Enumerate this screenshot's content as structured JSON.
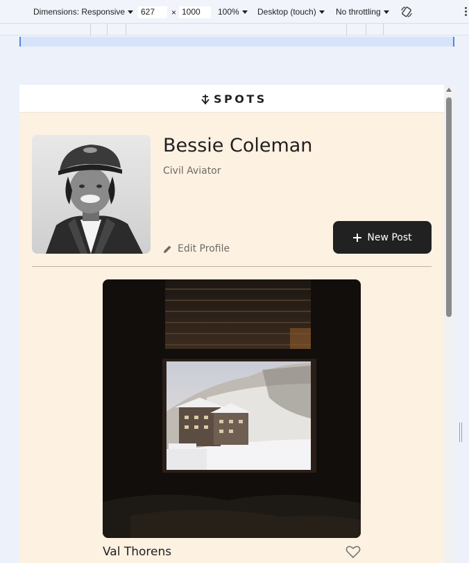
{
  "devtools": {
    "dimensions_label": "Dimensions: Responsive",
    "width_value": "627",
    "times": "×",
    "height_value": "1000",
    "zoom": "100%",
    "device_type": "Desktop (touch)",
    "throttling": "No throttling",
    "rotate_icon": "rotate-icon",
    "more_icon": "kebab-icon"
  },
  "site": {
    "logo_text": "SPOTS",
    "logo_icon": "spots-logo-icon"
  },
  "profile": {
    "name": "Bessie Coleman",
    "title": "Civil Aviator",
    "edit_label": "Edit Profile",
    "edit_icon": "pencil-icon",
    "new_post_label": "New Post",
    "new_post_icon": "plus-icon"
  },
  "cards": [
    {
      "title": "Val Thorens",
      "like_icon": "heart-outline-icon"
    }
  ],
  "colors": {
    "page_background": "#fdf1e2",
    "header_background": "#ffffff",
    "button_background": "#212121",
    "text_primary": "#212121",
    "text_secondary": "#6d6a65"
  }
}
